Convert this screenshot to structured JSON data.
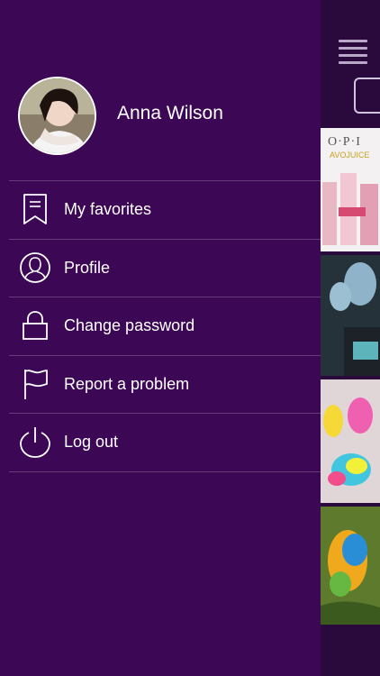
{
  "user": {
    "name": "Anna Wilson"
  },
  "menu": [
    {
      "label": "My favorites",
      "icon": "bookmark-icon"
    },
    {
      "label": "Profile",
      "icon": "user-icon"
    },
    {
      "label": "Change password",
      "icon": "lock-icon"
    },
    {
      "label": "Report a problem",
      "icon": "flag-icon"
    },
    {
      "label": "Log out",
      "icon": "power-icon"
    }
  ],
  "behind": {
    "tile1_text1": "O·P·I",
    "tile1_text2": "AVOJUICE"
  },
  "colors": {
    "drawer_bg": "#3c0754",
    "text": "#ffffff"
  }
}
